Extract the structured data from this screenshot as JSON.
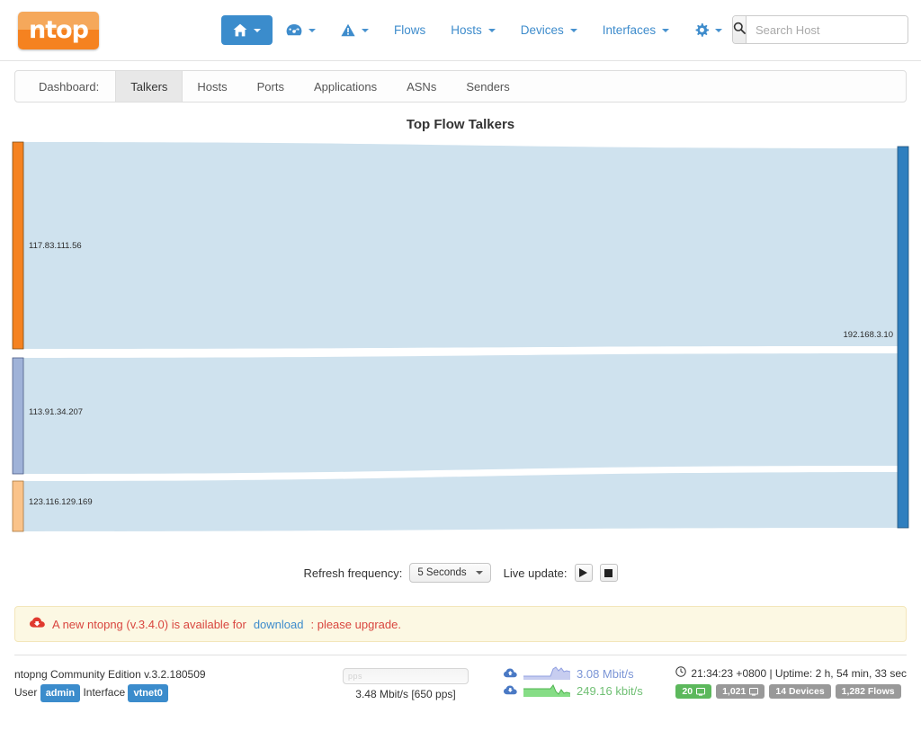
{
  "navbar": {
    "brand": "ntop",
    "items": [
      {
        "label": "",
        "icon": "home-icon",
        "active": true,
        "caret": true
      },
      {
        "label": "",
        "icon": "dashboard-gauge-icon",
        "active": false,
        "caret": true
      },
      {
        "label": "",
        "icon": "alert-triangle-icon",
        "active": false,
        "caret": true
      },
      {
        "label": "Flows",
        "icon": "",
        "active": false,
        "caret": false
      },
      {
        "label": "Hosts",
        "icon": "",
        "active": false,
        "caret": true
      },
      {
        "label": "Devices",
        "icon": "",
        "active": false,
        "caret": true
      },
      {
        "label": "Interfaces",
        "icon": "",
        "active": false,
        "caret": true
      },
      {
        "label": "",
        "icon": "gear-icon",
        "active": false,
        "caret": true
      },
      {
        "label": "",
        "icon": "power-icon",
        "active": false,
        "caret": true
      }
    ],
    "search": {
      "placeholder": "Search Host",
      "value": ""
    }
  },
  "subnav": {
    "label": "Dashboard:",
    "tabs": [
      {
        "label": "Talkers",
        "active": true
      },
      {
        "label": "Hosts",
        "active": false
      },
      {
        "label": "Ports",
        "active": false
      },
      {
        "label": "Applications",
        "active": false
      },
      {
        "label": "ASNs",
        "active": false
      },
      {
        "label": "Senders",
        "active": false
      }
    ]
  },
  "chart_data": {
    "type": "sankey",
    "title": "Top Flow Talkers",
    "xlabel": "",
    "ylabel": "",
    "nodes": [
      {
        "id": "src0",
        "name": "117.83.111.56",
        "side": "left",
        "color": "#f58220"
      },
      {
        "id": "src1",
        "name": "113.91.34.207",
        "side": "left",
        "color": "#9fb2d8"
      },
      {
        "id": "src2",
        "name": "123.116.129.169",
        "side": "left",
        "color": "#fac38a"
      },
      {
        "id": "dst0",
        "name": "192.168.3.10",
        "side": "right",
        "color": "#2f7fbf"
      }
    ],
    "links": [
      {
        "source": "117.83.111.56",
        "target": "192.168.3.10",
        "value": 54
      },
      {
        "source": "113.91.34.207",
        "target": "192.168.3.10",
        "value": 31
      },
      {
        "source": "123.116.129.169",
        "target": "192.168.3.10",
        "value": 15
      }
    ],
    "link_color": "#cfe2ee",
    "legend": "none",
    "grid": false
  },
  "controls": {
    "refresh_label": "Refresh frequency:",
    "refresh_value": "5 Seconds",
    "live_label": "Live update:",
    "play_icon": "play-icon",
    "stop_icon": "stop-icon"
  },
  "alert": {
    "icon": "cloud-download-alert-icon",
    "text_before": "A new ntopng (v.3.4.0) is available for ",
    "link": "download",
    "text_after": ": please upgrade."
  },
  "footer": {
    "version": "ntopng Community Edition v.3.2.180509",
    "user_label": "User",
    "user": "admin",
    "interface_label": "Interface",
    "interface": "vtnet0",
    "gauge_label": "pps",
    "throughput": "3.48 Mbit/s [650 pps]",
    "upload_rate": "3.08 Mbit/s",
    "download_rate": "249.16 kbit/s",
    "clock_icon": "clock-icon",
    "uptime": "21:34:23 +0800 | Uptime: 2 h, 54 min, 33 sec",
    "chips": [
      {
        "value": "20",
        "icon": "monitor-icon",
        "green": true
      },
      {
        "value": "1,021",
        "icon": "monitor-icon",
        "green": false
      },
      {
        "value": "14 Devices",
        "icon": "",
        "green": false
      },
      {
        "value": "1,282 Flows",
        "icon": "",
        "green": false
      }
    ]
  }
}
